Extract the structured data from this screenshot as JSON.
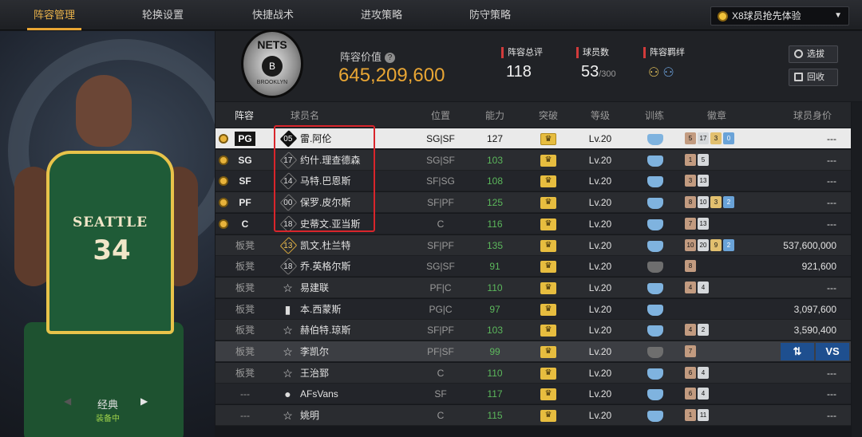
{
  "nav": {
    "tabs": [
      "阵容管理",
      "轮换设置",
      "快捷战术",
      "进攻策略",
      "防守策略"
    ],
    "promo_label": "X8球员抢先体验"
  },
  "player_panel": {
    "jersey_team": "SEATTLE",
    "jersey_number": "34",
    "style_label": "经典",
    "equipped_label": "装备中"
  },
  "team": {
    "logo_text": "NETS",
    "logo_ball": "B",
    "logo_sub": "BROOKLYN",
    "value_label": "阵容价值",
    "value": "645,209,600",
    "rating_label": "阵容总评",
    "rating": "118",
    "count_label": "球员数",
    "count": "53",
    "count_max": "/300",
    "bond_label": "阵容羁绊",
    "select_button": "选拔",
    "recycle_button": "回收"
  },
  "table": {
    "headers": [
      "阵容",
      "球员名",
      "位置",
      "能力",
      "突破",
      "等级",
      "训练",
      "徽章",
      "球员身价"
    ],
    "rows": [
      {
        "slot": "PG",
        "num": "05",
        "name": "雷.阿伦",
        "pos": "SG|SF",
        "ability": "127",
        "level": "Lv.20",
        "badges": [
          "5",
          "17",
          "3",
          "0"
        ],
        "value": "---"
      },
      {
        "slot": "SG",
        "num": "17",
        "name": "约什.理查德森",
        "pos": "SG|SF",
        "ability": "103",
        "level": "Lv.20",
        "badges": [
          "1",
          "5"
        ],
        "value": "---"
      },
      {
        "slot": "SF",
        "num": "14",
        "name": "马特.巴恩斯",
        "pos": "SF|SG",
        "ability": "108",
        "level": "Lv.20",
        "badges": [
          "3",
          "13"
        ],
        "value": "---"
      },
      {
        "slot": "PF",
        "num": "00",
        "name": "保罗.皮尔斯",
        "pos": "SF|PF",
        "ability": "125",
        "level": "Lv.20",
        "badges": [
          "8",
          "10",
          "3",
          "2"
        ],
        "value": "---"
      },
      {
        "slot": "C",
        "num": "18",
        "name": "史蒂文.亚当斯",
        "pos": "C",
        "ability": "116",
        "level": "Lv.20",
        "badges": [
          "7",
          "13"
        ],
        "value": "---"
      },
      {
        "slot": "板凳",
        "num": "13",
        "name": "凯文.杜兰特",
        "pos": "SF|PF",
        "ability": "135",
        "level": "Lv.20",
        "badges": [
          "10",
          "20",
          "9",
          "2"
        ],
        "value": "537,600,000"
      },
      {
        "slot": "板凳",
        "num": "18",
        "name": "乔.英格尔斯",
        "pos": "SG|SF",
        "ability": "91",
        "level": "Lv.20",
        "badges": [
          "8"
        ],
        "value": "921,600"
      },
      {
        "slot": "板凳",
        "num": "",
        "name": "易建联",
        "pos": "PF|C",
        "ability": "110",
        "level": "Lv.20",
        "badges": [
          "4",
          "4"
        ],
        "value": "---"
      },
      {
        "slot": "板凳",
        "num": "",
        "name": "本.西蒙斯",
        "pos": "PG|C",
        "ability": "97",
        "level": "Lv.20",
        "badges": [],
        "value": "3,097,600"
      },
      {
        "slot": "板凳",
        "num": "",
        "name": "赫伯特.琼斯",
        "pos": "SF|PF",
        "ability": "103",
        "level": "Lv.20",
        "badges": [
          "4",
          "2"
        ],
        "value": "3,590,400"
      },
      {
        "slot": "板凳",
        "num": "",
        "name": "李凯尔",
        "pos": "PF|SF",
        "ability": "99",
        "level": "Lv.20",
        "badges": [
          "7"
        ],
        "value": ""
      },
      {
        "slot": "板凳",
        "num": "",
        "name": "王治郅",
        "pos": "C",
        "ability": "110",
        "level": "Lv.20",
        "badges": [
          "6",
          "4"
        ],
        "value": "---"
      },
      {
        "slot": "---",
        "num": "",
        "name": "AFsVans",
        "pos": "SF",
        "ability": "117",
        "level": "Lv.20",
        "badges": [
          "6",
          "4"
        ],
        "value": "---"
      },
      {
        "slot": "---",
        "num": "",
        "name": "姚明",
        "pos": "C",
        "ability": "115",
        "level": "Lv.20",
        "badges": [
          "1",
          "11"
        ],
        "value": "---"
      }
    ],
    "vs_label": "VS",
    "swap_icon": "swap-arrows-icon"
  }
}
